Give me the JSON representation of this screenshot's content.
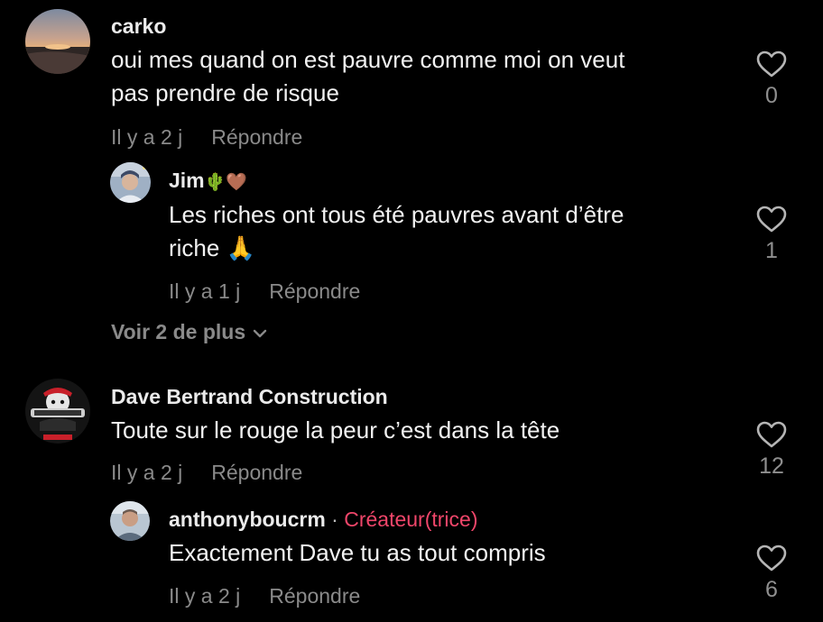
{
  "comments": [
    {
      "username": "carko",
      "text_line1": "oui mes quand on est pauvre comme moi on veut",
      "text_line2": "pas prendre de risque",
      "time": "Il y a 2 j",
      "reply_label": "Répondre",
      "likes": "0"
    },
    {
      "username": "Jim",
      "username_emoji": "🌵🤎",
      "text_line1": "Les riches ont tous été pauvres avant d’être",
      "text_line2": "riche 🙏",
      "time": "Il y a 1 j",
      "reply_label": "Répondre",
      "likes": "1"
    },
    {
      "username": "Dave Bertrand Construction",
      "text_line1": "Toute sur le rouge la peur c’est dans la tête",
      "time": "Il y a 2 j",
      "reply_label": "Répondre",
      "likes": "12"
    },
    {
      "username": "anthonyboucrm",
      "separator": " · ",
      "creator_badge": "Créateur(trice)",
      "text_line1": "Exactement Dave tu as tout compris",
      "time": "Il y a 2 j",
      "reply_label": "Répondre",
      "likes": "6"
    }
  ],
  "view_more_label": "Voir 2 de plus",
  "colors": {
    "background": "#000000",
    "creator": "#f0466a",
    "muted": "#8a8a8a"
  },
  "icons": [
    "heart-outline-icon",
    "chevron-down-icon"
  ]
}
